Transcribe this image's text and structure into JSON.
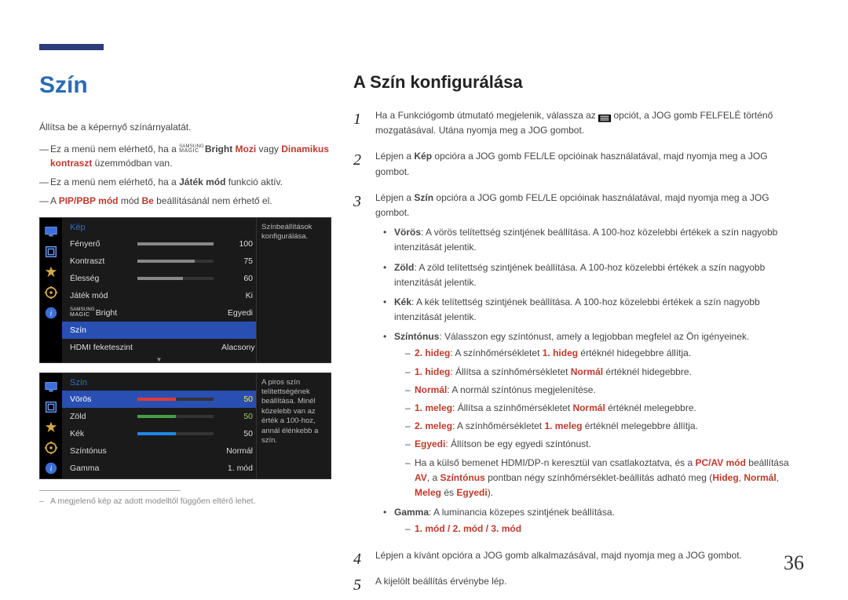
{
  "page_number": "36",
  "left": {
    "title": "Szín",
    "intro": "Állítsa be a képernyő színárnyalatát.",
    "notes": {
      "n1_pre": "Ez a menü nem elérhető, ha a ",
      "n1_mid": "Bright ",
      "n1_mozi": "Mozi",
      "n1_vagy": " vagy ",
      "n1_dk": "Dinamikus kontraszt",
      "n1_post": " üzemmódban van.",
      "n2_pre": "Ez a menü nem elérhető, ha a ",
      "n2_bold": "Játék mód",
      "n2_post": " funkció aktív.",
      "n3_pre": "A ",
      "n3_b1": "PIP/PBP mód",
      "n3_mid": " mód ",
      "n3_b2": "Be",
      "n3_post": " beállításánál nem érhető el."
    },
    "footnote": "A megjelenő kép az adott modelltől függően eltérő lehet.",
    "osd1": {
      "header": "Kép",
      "help": "Színbeállítások konfigurálása.",
      "rows": [
        {
          "label": "Fényerő",
          "value": "100",
          "pct": 100,
          "bar": true
        },
        {
          "label": "Kontraszt",
          "value": "75",
          "pct": 75,
          "bar": true
        },
        {
          "label": "Élesség",
          "value": "60",
          "pct": 60,
          "bar": true
        },
        {
          "label": "Játék mód",
          "value": "Ki",
          "bar": false
        },
        {
          "label": "Bright",
          "samsung": true,
          "value": "Egyedi",
          "bar": false
        },
        {
          "label": "Szín",
          "value": "",
          "bar": false,
          "highlight": true
        },
        {
          "label": "HDMI feketeszint",
          "value": "Alacsony",
          "bar": false
        }
      ]
    },
    "osd2": {
      "header": "Szín",
      "help": "A piros szín telítettségének beállítása. Minél közelebb van az érték a 100-hoz, annál élénkebb a szín.",
      "rows": [
        {
          "label": "Vörös",
          "value": "50",
          "pct": 50,
          "bar": true,
          "color": "#e53935",
          "highlight": true,
          "valcolor": "#ffeb3b"
        },
        {
          "label": "Zöld",
          "value": "50",
          "pct": 50,
          "bar": true,
          "color": "#43a047",
          "valcolor": "#9ccc65"
        },
        {
          "label": "Kék",
          "value": "50",
          "pct": 50,
          "bar": true,
          "color": "#1e88e5"
        },
        {
          "label": "Színtónus",
          "value": "Normál",
          "bar": false
        },
        {
          "label": "Gamma",
          "value": "1. mód",
          "bar": false
        }
      ]
    }
  },
  "right": {
    "title": "A Szín konfigurálása",
    "step1_pre": "Ha a Funkciógomb útmutató megjelenik, válassza az ",
    "step1_post": " opciót, a JOG gomb FELFELÉ történő mozgatásával. Utána nyomja meg a JOG gombot.",
    "step2_pre": "Lépjen a ",
    "step2_b": "Kép",
    "step2_post": " opcióra a JOG gomb FEL/LE opcióinak használatával, majd nyomja meg a JOG gombot.",
    "step3_pre": "Lépjen a ",
    "step3_b": "Szín",
    "step3_post": " opcióra a JOG gomb FEL/LE opcióinak használatával, majd nyomja meg a JOG gombot.",
    "bul": {
      "voros_b": "Vörös",
      "voros": ": A vörös telítettség szintjének beállítása. A 100-hoz közelebbi értékek a szín nagyobb intenzitását jelentik.",
      "zold_b": "Zöld",
      "zold": ": A zöld telítettség szintjének beállítása. A 100-hoz közelebbi értékek a szín nagyobb intenzitását jelentik.",
      "kek_b": "Kék",
      "kek": ": A kék telítettség szintjének beállítása. A 100-hoz közelebbi értékek a szín nagyobb intenzitását jelentik.",
      "szin_b": "Színtónus",
      "szin": ": Válasszon egy színtónust, amely a legjobban megfelel az Ön igényeinek.",
      "s1_b": "2. hideg",
      "s1_m": ": A színhőmérsékletet ",
      "s1_b2": "1. hideg",
      "s1_e": " értéknél hidegebbre állítja.",
      "s2_b": "1. hideg",
      "s2_m": ": Állítsa a színhőmérsékletet ",
      "s2_b2": "Normál",
      "s2_e": " értéknél hidegebbre.",
      "s3_b": "Normál",
      "s3_e": ": A normál színtónus megjelenítése.",
      "s4_b": "1. meleg",
      "s4_m": ": Állítsa a színhőmérsékletet ",
      "s4_b2": "Normál",
      "s4_e": " értéknél melegebbre.",
      "s5_b": "2. meleg",
      "s5_m": ": A színhőmérsékletet ",
      "s5_b2": "1. meleg",
      "s5_e": " értéknél melegebbre állítja.",
      "s6_b": "Egyedi",
      "s6_e": ": Állítson be egy egyedi színtónust.",
      "note_pre": "Ha a külső bemenet HDMI/DP-n keresztül van csatlakoztatva, és a ",
      "note_b1": "PC/AV mód",
      "note_m1": " beállítása ",
      "note_b2": "AV",
      "note_m2": ", a ",
      "note_b3": "Színtónus",
      "note_m3": " pontban négy színhőmérséklet-beállítás adható meg (",
      "note_c1": "Hideg",
      "note_c2": "Normál",
      "note_c3": "Meleg",
      "note_c4": "Egyedi",
      "note_end": ").",
      "gamma_b": "Gamma",
      "gamma": ": A luminancia közepes szintjének beállítása.",
      "gamma_modes": "1. mód / 2. mód / 3. mód"
    },
    "step4": "Lépjen a kívánt opcióra a JOG gomb alkalmazásával, majd nyomja meg a JOG gombot.",
    "step5": "A kijelölt beállítás érvénybe lép."
  }
}
